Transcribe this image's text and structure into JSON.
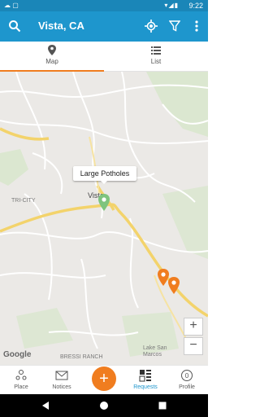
{
  "status_bar": {
    "time": "9:22",
    "left_icons": [
      "cloud-icon",
      "notification-icon"
    ],
    "right_icons": [
      "wifi-icon",
      "signal-icon",
      "battery-icon"
    ]
  },
  "app_bar": {
    "title": "Vista, CA",
    "background": "#1e96cd",
    "icons": [
      "search-icon",
      "locate-icon",
      "filter-icon",
      "more-vert-icon"
    ]
  },
  "tabs": [
    {
      "label": "Map",
      "icon": "map-pin-icon",
      "active": true
    },
    {
      "label": "List",
      "icon": "list-icon",
      "active": false
    }
  ],
  "map": {
    "callout": "Large Potholes",
    "city_label": "Vista",
    "labels": [
      "TRI-CITY",
      "BRESSI RANCH",
      "Lake San Marcos"
    ],
    "markers": [
      {
        "color": "#7ec47e",
        "type": "pin-green"
      },
      {
        "color": "#f07d1f",
        "type": "pin-orange"
      },
      {
        "color": "#f07d1f",
        "type": "pin-orange"
      }
    ],
    "zoom_in": "+",
    "zoom_out": "−",
    "attribution": "Google"
  },
  "bottom_nav": [
    {
      "label": "Place",
      "icon": "place-icon",
      "active": false
    },
    {
      "label": "Notices",
      "icon": "mail-icon",
      "active": false
    },
    {
      "label": "Requests",
      "icon": "requests-icon",
      "active": true
    },
    {
      "label": "Profile",
      "icon": "profile-icon",
      "active": false
    }
  ],
  "fab": {
    "label": "+",
    "color": "#f07d1f"
  },
  "system_nav": [
    "back-icon",
    "home-icon",
    "recents-icon"
  ]
}
